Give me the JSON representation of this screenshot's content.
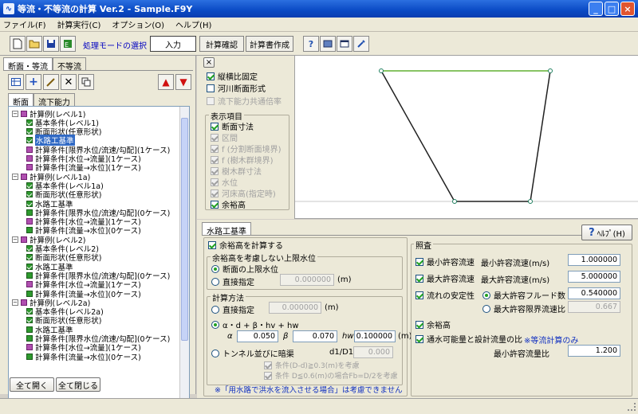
{
  "window": {
    "title": "等流・不等流の計算 Ver.2 - Sample.F9Y"
  },
  "menu": [
    "ファイル(F)",
    "計算実行(C)",
    "オプション(O)",
    "ヘルプ(H)"
  ],
  "toolbar": {
    "mode_label": "処理モードの選択",
    "modes": [
      "入力",
      "計算確認",
      "計算書作成"
    ],
    "active_mode": "入力"
  },
  "left": {
    "top_tabs": [
      "断面・等流",
      "不等流"
    ],
    "sub_tabs": [
      "断面",
      "流下能力"
    ],
    "tree": [
      {
        "level": 0,
        "icon": "m",
        "label": "計算例(レベル1)"
      },
      {
        "level": 1,
        "icon": "c",
        "label": "基本条件(レベル1)"
      },
      {
        "level": 1,
        "icon": "c",
        "label": "断面形状(任意形状)"
      },
      {
        "level": 1,
        "icon": "c",
        "label": "水路工基準",
        "selected": true
      },
      {
        "level": 1,
        "icon": "m",
        "label": "計算条件[限界水位/流速/勾配](1ケース)"
      },
      {
        "level": 1,
        "icon": "m",
        "label": "計算条件[水位→流量](1ケース)"
      },
      {
        "level": 1,
        "icon": "m",
        "label": "計算条件[流量→水位](1ケース)"
      },
      {
        "level": 0,
        "icon": "m",
        "label": "計算例(レベル1a)"
      },
      {
        "level": 1,
        "icon": "c",
        "label": "基本条件(レベル1a)"
      },
      {
        "level": 1,
        "icon": "c",
        "label": "断面形状(任意形状)"
      },
      {
        "level": 1,
        "icon": "c",
        "label": "水路工基準"
      },
      {
        "level": 1,
        "icon": "g",
        "label": "計算条件[限界水位/流速/勾配](0ケース)"
      },
      {
        "level": 1,
        "icon": "m",
        "label": "計算条件[水位→流量](1ケース)"
      },
      {
        "level": 1,
        "icon": "g",
        "label": "計算条件[流量→水位](0ケース)"
      },
      {
        "level": 0,
        "icon": "m",
        "label": "計算例(レベル2)"
      },
      {
        "level": 1,
        "icon": "c",
        "label": "基本条件(レベル2)"
      },
      {
        "level": 1,
        "icon": "c",
        "label": "断面形状(任意形状)"
      },
      {
        "level": 1,
        "icon": "c",
        "label": "水路工基準"
      },
      {
        "level": 1,
        "icon": "g",
        "label": "計算条件[限界水位/流速/勾配](0ケース)"
      },
      {
        "level": 1,
        "icon": "m",
        "label": "計算条件[水位→流量](1ケース)"
      },
      {
        "level": 1,
        "icon": "g",
        "label": "計算条件[流量→水位](0ケース)"
      },
      {
        "level": 0,
        "icon": "m",
        "label": "計算例(レベル2a)"
      },
      {
        "level": 1,
        "icon": "c",
        "label": "基本条件(レベル2a)"
      },
      {
        "level": 1,
        "icon": "c",
        "label": "断面形状(任意形状)"
      },
      {
        "level": 1,
        "icon": "g",
        "label": "水路工基準"
      },
      {
        "level": 1,
        "icon": "g",
        "label": "計算条件[限界水位/流速/勾配](0ケース)"
      },
      {
        "level": 1,
        "icon": "m",
        "label": "計算条件[水位→流量](1ケース)"
      },
      {
        "level": 1,
        "icon": "g",
        "label": "計算条件[流量→水位](0ケース)"
      }
    ],
    "expand_all": "全て開く",
    "collapse_all": "全て閉じる"
  },
  "display": {
    "close": "×",
    "fixed_ratio": "縦横比固定",
    "river_section": "河川断面形式",
    "capacity_factor": "流下能力共通倍率",
    "group_title": "表示項目",
    "items": [
      {
        "label": "断面寸法",
        "checked": true,
        "enabled": true
      },
      {
        "label": "区間",
        "checked": true,
        "enabled": false
      },
      {
        "label": "f (分割断面境界)",
        "checked": true,
        "enabled": false
      },
      {
        "label": "f (樹木群境界)",
        "checked": true,
        "enabled": false
      },
      {
        "label": "樹木群寸法",
        "checked": true,
        "enabled": false
      },
      {
        "label": "水位",
        "checked": true,
        "enabled": false
      },
      {
        "label": "河床高(指定時)",
        "checked": true,
        "enabled": false
      },
      {
        "label": "余裕高",
        "checked": true,
        "enabled": true
      }
    ]
  },
  "form": {
    "tab": "水路工基準",
    "help": "ﾍﾙﾌﾟ(H)",
    "calc_freeboard": "余裕高を計算する",
    "upper_group": "余裕高を考慮しない上限水位",
    "upper_opt1": "断面の上限水位",
    "upper_opt2": "直接指定",
    "upper_value": "0.000000",
    "unit_m": "(m)",
    "method_group": "計算方法",
    "method_opt1": "直接指定",
    "method_value": "0.000000",
    "method_opt2": "α・d + β・hv + hw",
    "alpha_label": "α",
    "alpha": "0.050",
    "beta_label": "β",
    "beta": "0.070",
    "hw_label": "hw",
    "hw": "0.100000",
    "method_opt3": "トンネル並びに暗渠",
    "d1d_label": "d1/D1",
    "d1d": "0.000",
    "cond1": "条件(D-d)≧0.3(m)を考慮",
    "cond2": "条件 D≦0.6(m)の場合Fb=D/2を考慮",
    "note": "※「用水路で洪水を流入させる場合」は考慮できません"
  },
  "check": {
    "title": "照査",
    "rows": [
      {
        "check": "最小許容流速",
        "label": "最小許容流速(m/s)",
        "value": "1.000000"
      },
      {
        "check": "最大許容流速",
        "label": "最大許容流速(m/s)",
        "value": "5.000000"
      }
    ],
    "stability": "流れの安定性",
    "froude_label": "最大許容フルード数",
    "froude": "0.540000",
    "crit_label": "最大許容限界流速比",
    "crit": "0.667",
    "freeboard": "余裕高",
    "ratio_check": "通水可能量と設計流量の比",
    "ratio_note": "※等流計算のみ",
    "min_ratio_label": "最小許容流量比",
    "min_ratio": "1.200"
  }
}
